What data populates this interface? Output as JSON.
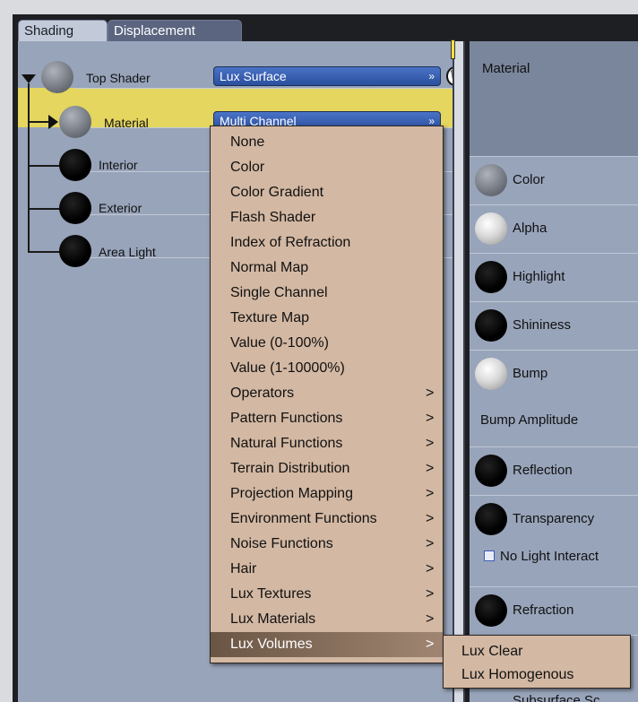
{
  "tabs": {
    "shading": "Shading",
    "displacement": "Displacement"
  },
  "tree": {
    "top_shader": "Top Shader",
    "material": "Material",
    "interior": "Interior",
    "exterior": "Exterior",
    "area_light": "Area Light"
  },
  "dropdowns": {
    "top_shader_value": "Lux Surface",
    "material_value": "Multi Channel",
    "chevron": "»"
  },
  "trash_glyph": "🗑",
  "right_panel": {
    "title": "Material",
    "properties": [
      "Color",
      "Alpha",
      "Highlight",
      "Shininess",
      "Bump"
    ],
    "bump_amplitude": "Bump Amplitude",
    "properties2": [
      "Reflection",
      "Transparency"
    ],
    "no_light_interaction": "No Light Interact",
    "refraction": "Refraction",
    "subsurface_partial": "Subsurface Sc"
  },
  "menu": {
    "items": [
      "None",
      "Color",
      "Color Gradient",
      "Flash Shader",
      "Index of Refraction",
      "Normal Map",
      "Single Channel",
      "Texture Map",
      "Value (0-100%)",
      "Value (1-10000%)",
      "Operators",
      "Pattern Functions",
      "Natural Functions",
      "Terrain Distribution",
      "Projection Mapping",
      "Environment Functions",
      "Noise Functions",
      "Hair",
      "Lux Textures",
      "Lux Materials",
      "Lux Volumes"
    ],
    "submenu_arrow": ">",
    "submenu_items": [
      "Lux Clear",
      "Lux Homogenous"
    ]
  }
}
